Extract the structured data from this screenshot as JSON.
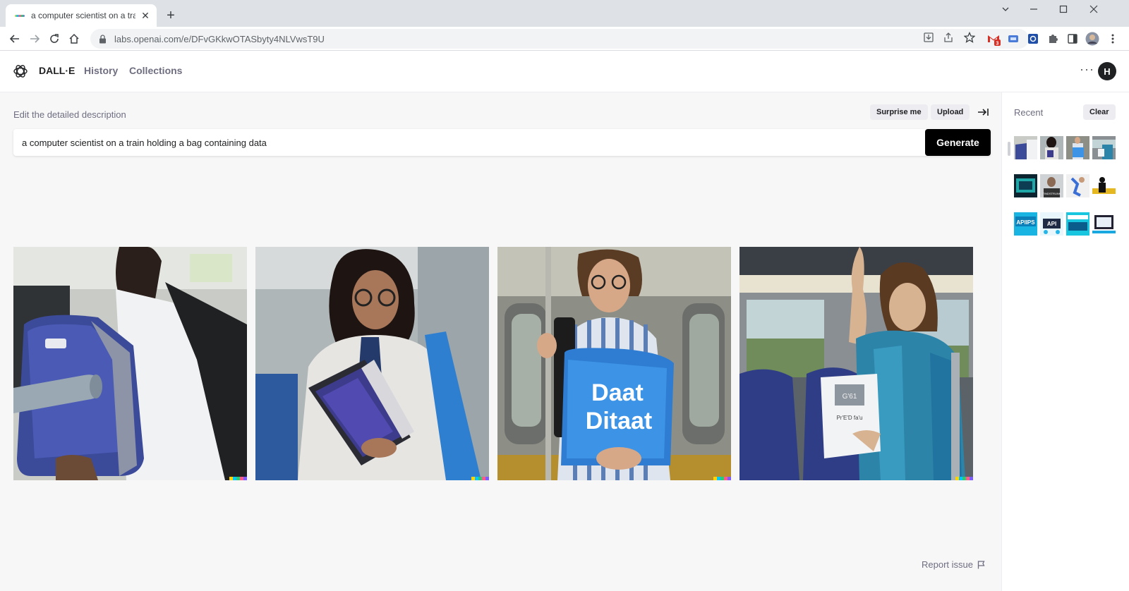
{
  "browser": {
    "tab_title": "a computer scientist on a train holding a bag containing data",
    "tab_close": "✕",
    "new_tab": "+",
    "url": "labs.openai.com/e/DFvGKkwOTASbyty4NLVwsT9U",
    "gmail_badge": "3"
  },
  "header": {
    "brand": "DALL·E",
    "nav": [
      "History",
      "Collections"
    ],
    "more": "···",
    "avatar_initial": "H"
  },
  "editor": {
    "label": "Edit the detailed description",
    "surprise_label": "Surprise me",
    "upload_label": "Upload",
    "prompt_value": "a computer scientist on a train holding a bag containing data",
    "generate_label": "Generate"
  },
  "results": {
    "images": [
      {
        "name": "result-image-1",
        "bag_text": ""
      },
      {
        "name": "result-image-2",
        "bag_text": ""
      },
      {
        "name": "result-image-3",
        "bag_text_1": "Daat",
        "bag_text_2": "Ditaat"
      },
      {
        "name": "result-image-4",
        "bag_text_1": "G'61",
        "bag_text_2": "Pr'E'D fa'u"
      }
    ],
    "report_label": "Report issue"
  },
  "recent": {
    "title": "Recent",
    "clear_label": "Clear",
    "thumb_texts": [
      "",
      "",
      "",
      "",
      "",
      "TINDSTRUNK",
      "",
      "",
      "APIIPS",
      "API",
      "",
      ""
    ]
  },
  "colors": {
    "generate_bg": "#000000",
    "accent_pill": "#ececf1",
    "gmail_red": "#d93025"
  },
  "icons": {
    "back": "back-arrow-icon",
    "forward": "forward-arrow-icon",
    "reload": "reload-icon",
    "home": "home-icon",
    "lock": "lock-icon",
    "install": "install-icon",
    "share": "share-icon",
    "star": "star-icon",
    "extensions": "puzzle-icon",
    "sidepanel": "side-panel-icon",
    "menu": "kebab-menu-icon",
    "collapse": "collapse-arrow-icon",
    "flag": "flag-icon"
  }
}
